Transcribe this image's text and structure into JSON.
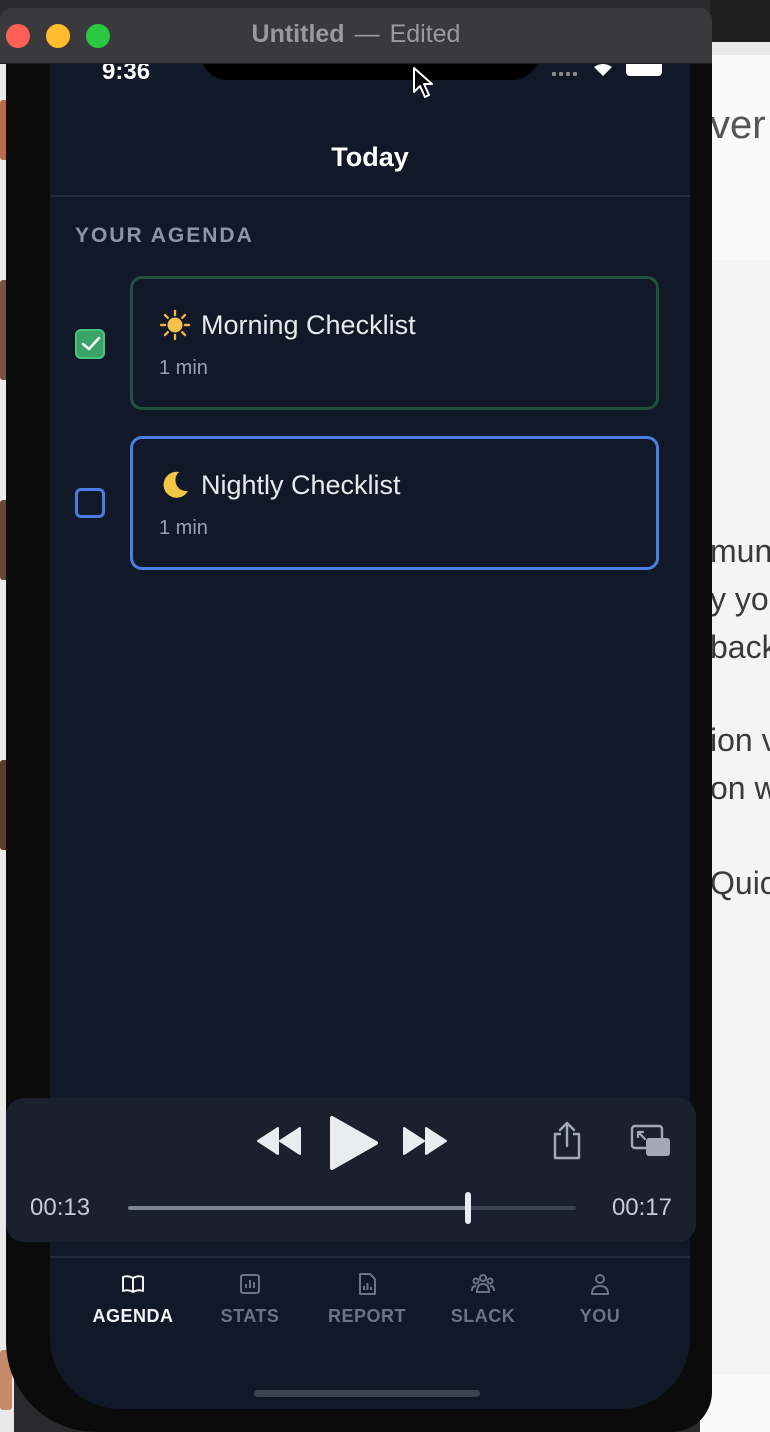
{
  "window": {
    "title": "Untitled",
    "separator": "—",
    "status": "Edited"
  },
  "status_bar": {
    "time": "9:36"
  },
  "nav": {
    "title": "Today"
  },
  "agenda": {
    "section_label": "YOUR AGENDA",
    "items": [
      {
        "title": "Morning Checklist",
        "duration": "1 min",
        "completed": true,
        "icon": "sun-icon"
      },
      {
        "title": "Nightly Checklist",
        "duration": "1 min",
        "completed": false,
        "icon": "moon-icon"
      }
    ]
  },
  "player": {
    "elapsed": "00:13",
    "total": "00:17",
    "progress": 0.76,
    "controls": [
      "rewind-icon",
      "play-icon",
      "fast-forward-icon",
      "share-icon",
      "picture-in-picture-icon"
    ]
  },
  "tabs": [
    {
      "label": "AGENDA",
      "icon": "book-icon",
      "active": true
    },
    {
      "label": "STATS",
      "icon": "stats-icon",
      "active": false
    },
    {
      "label": "REPORT",
      "icon": "report-icon",
      "active": false
    },
    {
      "label": "SLACK",
      "icon": "group-icon",
      "active": false
    },
    {
      "label": "YOU",
      "icon": "person-icon",
      "active": false
    }
  ],
  "background_doc": {
    "fragments": [
      "ver",
      "mun",
      "y yo",
      "back",
      "ion v",
      "on w",
      "Quic"
    ]
  },
  "colors": {
    "screen_bg": "#111827",
    "accent_blue": "#4a7fe2",
    "accent_green": "#3aa36a",
    "card_border_done": "#21503d"
  }
}
